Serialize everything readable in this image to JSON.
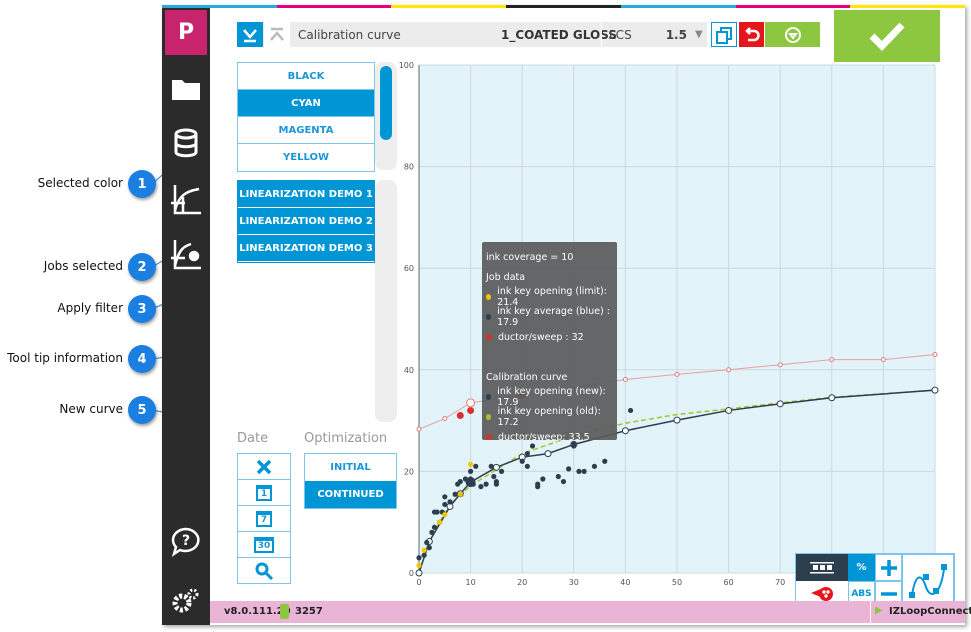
{
  "callouts": [
    {
      "num": "1",
      "label": "Selected color"
    },
    {
      "num": "2",
      "label": "Jobs selected"
    },
    {
      "num": "3",
      "label": "Apply filter"
    },
    {
      "num": "4",
      "label": "Tool tip information"
    },
    {
      "num": "5",
      "label": "New curve"
    }
  ],
  "sidebar": {
    "logo": "P",
    "icons": [
      "folder-icon",
      "database-icon",
      "curve-icon",
      "curve-settings-icon",
      "help-icon",
      "settings-icon"
    ]
  },
  "header": {
    "title": "Calibration curve",
    "paper": "1_COATED GLOSS",
    "standard": "LCS",
    "value": "1.5"
  },
  "colors": {
    "items": [
      "BLACK",
      "CYAN",
      "MAGENTA",
      "YELLOW"
    ],
    "selected": "CYAN"
  },
  "jobs": {
    "items": [
      "LINEARIZATION DEMO 1",
      "LINEARIZATION DEMO 2",
      "LINEARIZATION DEMO 3"
    ]
  },
  "date": {
    "label": "Date",
    "buttons": [
      "clear",
      "1",
      "7",
      "30",
      "search"
    ]
  },
  "optimization": {
    "label": "Optimization",
    "items": [
      "INITIAL",
      "CONTINUED"
    ],
    "selected": "CONTINUED"
  },
  "footer": {
    "version": "v8.0.111.20",
    "count": "3257",
    "connect": "IZLoopConnect"
  },
  "controls": {
    "percent": "%",
    "abs": "ABS"
  },
  "tooltip": {
    "title": "ink coverage = 10",
    "job_header": "Job data",
    "job": [
      {
        "label": "ink key opening (limit): 21.4",
        "color": "#f5c400"
      },
      {
        "label": "ink key average (blue) : 17.9",
        "color": "#2d3e4e"
      },
      {
        "label": "ductor/sweep : 32",
        "color": "#d9302c"
      }
    ],
    "curve_header": "Calibration curve",
    "curve": [
      {
        "label": "ink key opening (new): 17.9",
        "color": "#2d3e4e"
      },
      {
        "label": "ink key opening (old): 17.2",
        "color": "#a6c22e"
      },
      {
        "label": "ductor/sweep: 33.5",
        "color": "#d9302c"
      }
    ]
  },
  "chart_data": {
    "type": "line",
    "xlim": [
      0,
      100
    ],
    "ylim": [
      0,
      100
    ],
    "xticks": [
      0,
      10,
      20,
      30,
      40,
      50,
      60,
      70
    ],
    "yticks": [
      0,
      20,
      40,
      60,
      80,
      100
    ],
    "grid": true,
    "series": [
      {
        "key": "ductor",
        "color": "#e8a0a0",
        "x": [
          0,
          5,
          10,
          40,
          50,
          60,
          70,
          80,
          90,
          100
        ],
        "y": [
          28.3,
          30.4,
          33.5,
          38.1,
          39.1,
          40,
          41,
          42,
          42,
          43
        ]
      },
      {
        "key": "old",
        "color": "#a6c22e",
        "dashed": true,
        "x": [
          0,
          2,
          6,
          10,
          20,
          30,
          40,
          50,
          60,
          70,
          80,
          100
        ],
        "y": [
          0,
          6.5,
          13.5,
          17.2,
          23.5,
          27,
          29.5,
          31.2,
          32.3,
          33.5,
          34.6,
          36
        ]
      },
      {
        "key": "new",
        "color": "#2d3e4e",
        "x": [
          0,
          2,
          6,
          8,
          10,
          15,
          20,
          25,
          30,
          40,
          50,
          60,
          70,
          80,
          100
        ],
        "y": [
          0,
          6.2,
          13.1,
          15.6,
          17.9,
          20.8,
          22.8,
          23.5,
          25.3,
          28,
          30.1,
          32,
          33.3,
          34.5,
          36
        ]
      }
    ],
    "scatter_blue": {
      "color": "#2d3e4e",
      "x": [
        0,
        1,
        1.5,
        2,
        2.5,
        3,
        3,
        3.5,
        4,
        4.5,
        5,
        5,
        6,
        7,
        7.5,
        8,
        9,
        10,
        10,
        10.5,
        11,
        12,
        13,
        14,
        14.5,
        15,
        15,
        16,
        20,
        20,
        21,
        21,
        22,
        23,
        23,
        24,
        27,
        28,
        29,
        30,
        30,
        31,
        32,
        34,
        36,
        41
      ],
      "y": [
        3,
        3.5,
        6,
        5,
        8,
        12,
        9,
        12,
        10,
        12,
        13.5,
        15,
        14,
        15.5,
        17.5,
        18,
        18.5,
        20,
        18.5,
        17.5,
        21,
        17,
        17.5,
        21,
        19,
        17.5,
        18,
        20,
        22,
        35,
        23.5,
        21,
        25,
        17.5,
        17,
        18.5,
        19,
        18,
        20.5,
        25.5,
        25,
        20,
        20,
        21,
        22,
        32
      ]
    },
    "scatter_yellow": {
      "color": "#f5c400",
      "x": [
        0,
        1,
        4,
        5,
        8,
        10,
        21
      ],
      "y": [
        1.5,
        4.5,
        10,
        11.5,
        15.5,
        21.4,
        27
      ]
    },
    "scatter_red": {
      "color": "#d9302c",
      "x": [
        8,
        10,
        20
      ],
      "y": [
        31,
        32,
        35
      ]
    }
  }
}
